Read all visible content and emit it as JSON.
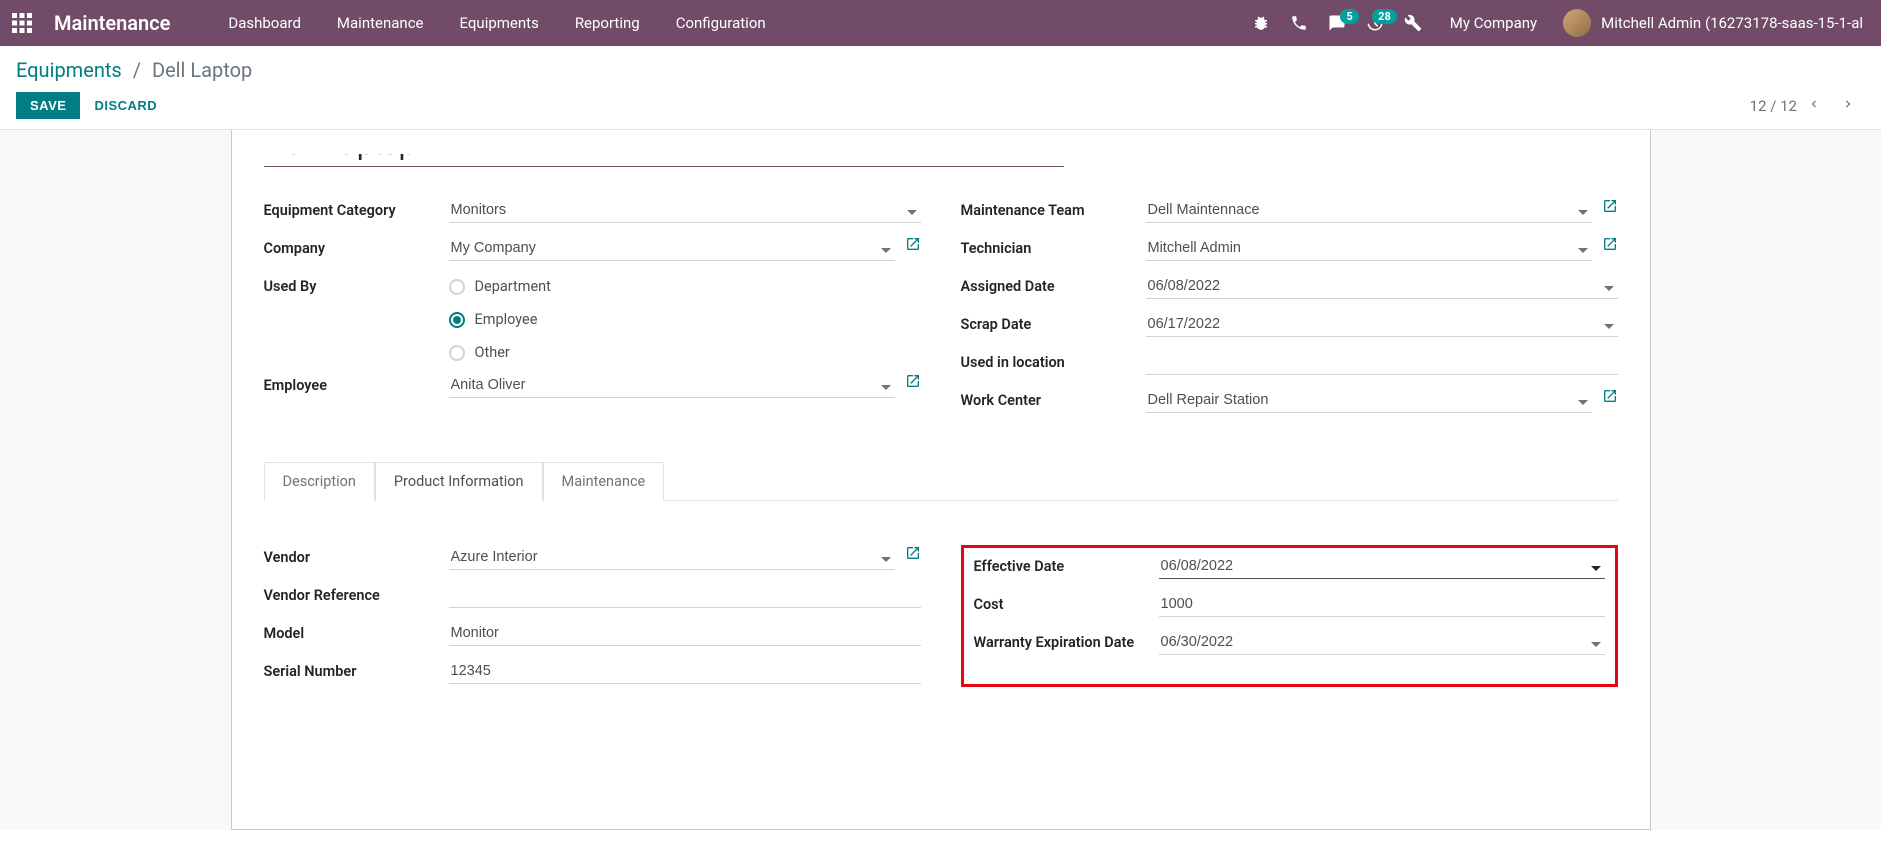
{
  "navbar": {
    "brand": "Maintenance",
    "links": [
      "Dashboard",
      "Maintenance",
      "Equipments",
      "Reporting",
      "Configuration"
    ],
    "chat_badge": "5",
    "activity_badge": "28",
    "company": "My Company",
    "user": "Mitchell Admin (16273178-saas-15-1-al"
  },
  "breadcrumb": {
    "root": "Equipments",
    "current": "Dell Laptop"
  },
  "buttons": {
    "save": "SAVE",
    "discard": "DISCARD"
  },
  "pager": "12 / 12",
  "record": {
    "name": "Dell Laptop",
    "labels": {
      "category": "Equipment Category",
      "company": "Company",
      "used_by": "Used By",
      "employee": "Employee",
      "team": "Maintenance Team",
      "technician": "Technician",
      "assigned": "Assigned Date",
      "scrap": "Scrap Date",
      "location": "Used in location",
      "workcenter": "Work Center",
      "vendor": "Vendor",
      "vendor_ref": "Vendor Reference",
      "model": "Model",
      "serial": "Serial Number",
      "effective": "Effective Date",
      "cost": "Cost",
      "warranty": "Warranty Expiration Date"
    },
    "values": {
      "category": "Monitors",
      "company": "My Company",
      "employee": "Anita Oliver",
      "team": "Dell Maintennace",
      "technician": "Mitchell Admin",
      "assigned": "06/08/2022",
      "scrap": "06/17/2022",
      "location": "",
      "workcenter": "Dell Repair Station",
      "vendor": "Azure Interior",
      "vendor_ref": "",
      "model": "Monitor",
      "serial": "12345",
      "effective": "06/08/2022",
      "cost": "1000",
      "warranty": "06/30/2022"
    },
    "used_by_options": {
      "department": "Department",
      "employee": "Employee",
      "other": "Other"
    }
  },
  "tabs": {
    "description": "Description",
    "product": "Product Information",
    "maintenance": "Maintenance"
  }
}
